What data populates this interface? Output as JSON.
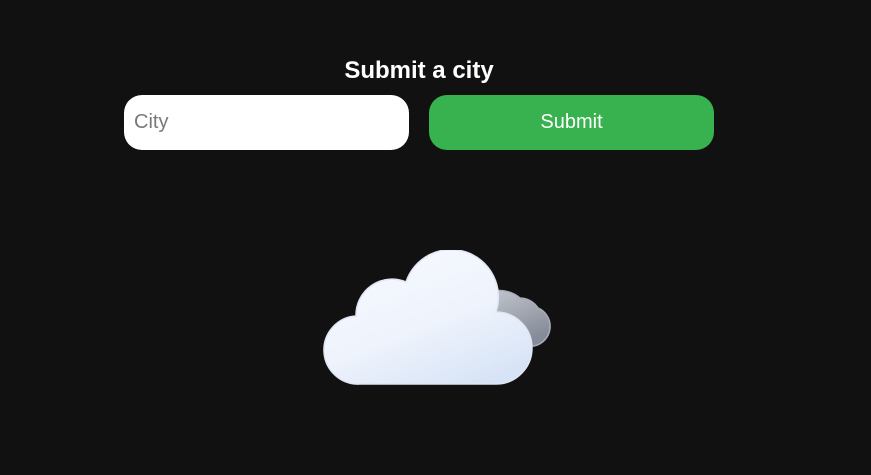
{
  "form": {
    "heading": "Submit a city",
    "city_placeholder": "City",
    "city_value": "",
    "submit_label": "Submit"
  },
  "weather": {
    "icon": "cloudy-icon"
  },
  "colors": {
    "background": "#111111",
    "submit_button": "#38b24e",
    "input_background": "#ffffff",
    "heading_text": "#ffffff"
  }
}
